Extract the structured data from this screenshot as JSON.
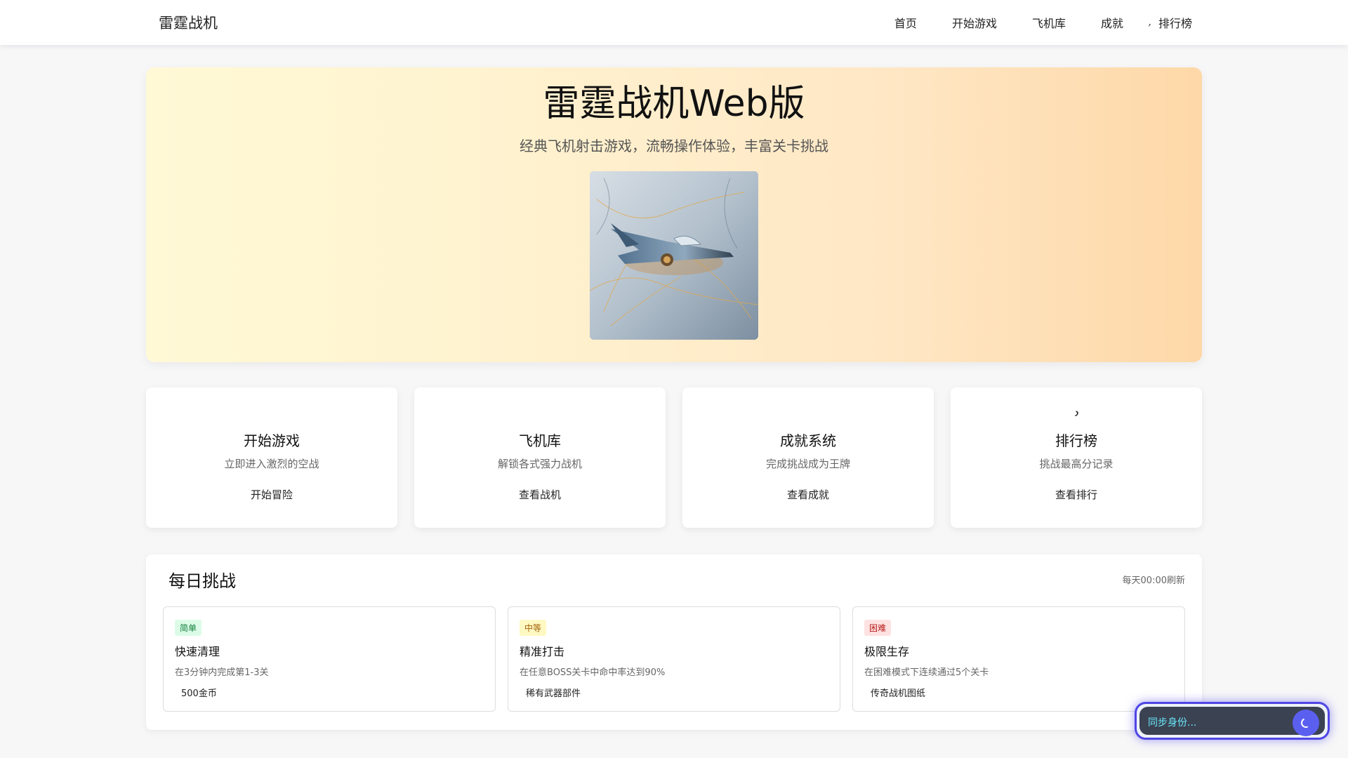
{
  "navbar": {
    "brand_icon": "plane-icon",
    "brand_glyph": "",
    "brand": "雷霆战机",
    "links": [
      {
        "label": "首页",
        "icon": "home-icon",
        "glyph": ""
      },
      {
        "label": "开始游戏",
        "icon": "gamepad-icon",
        "glyph": ""
      },
      {
        "label": "飞机库",
        "icon": "plane-icon",
        "glyph": ""
      },
      {
        "label": "成就",
        "icon": "trophy-icon",
        "glyph": ""
      },
      {
        "label": "排行榜",
        "icon": "ranking-icon",
        "glyph": "‚"
      }
    ]
  },
  "hero": {
    "title": "雷霆战机Web版",
    "subtitle": "经典飞机射击游戏，流畅操作体验，丰富关卡挑战"
  },
  "features": [
    {
      "icon": "gamepad-icon",
      "glyph": "",
      "title": "开始游戏",
      "desc": "立即进入激烈的空战",
      "button": "开始冒险"
    },
    {
      "icon": "plane-icon",
      "glyph": "",
      "title": "飞机库",
      "desc": "解锁各式强力战机",
      "button": "查看战机"
    },
    {
      "icon": "trophy-icon",
      "glyph": "",
      "title": "成就系统",
      "desc": "完成挑战成为王牌",
      "button": "查看成就"
    },
    {
      "icon": "ranking-icon",
      "glyph": "˒",
      "title": "排行榜",
      "desc": "挑战最高分记录",
      "button": "查看排行"
    }
  ],
  "daily": {
    "title": "每日挑战",
    "refresh": "每天00:00刷新",
    "challenges": [
      {
        "difficulty": "简单",
        "level": "easy",
        "title": "快速清理",
        "desc": "在3分钟内完成第1-3关",
        "reward_icon": "coin-icon",
        "reward_glyph": "",
        "reward": "500金币"
      },
      {
        "difficulty": "中等",
        "level": "medium",
        "title": "精准打击",
        "desc": "在任意BOSS关卡中命中率达到90%",
        "reward_icon": "gear-icon",
        "reward_glyph": "",
        "reward": "稀有武器部件"
      },
      {
        "difficulty": "困难",
        "level": "hard",
        "title": "极限生存",
        "desc": "在困难模式下连续通过5个关卡",
        "reward_icon": "blueprint-icon",
        "reward_glyph": "",
        "reward": "传奇战机图纸"
      }
    ]
  },
  "sync": {
    "text": "同步身份...",
    "accent": "#4f46e5",
    "text_color": "#67e8f9"
  },
  "colors": {
    "hero_gradient_start": "#fff9d6",
    "hero_gradient_end": "#fed8a8",
    "easy_badge": "#dcfce7",
    "medium_badge": "#fef9c3",
    "hard_badge": "#fee2e2"
  }
}
